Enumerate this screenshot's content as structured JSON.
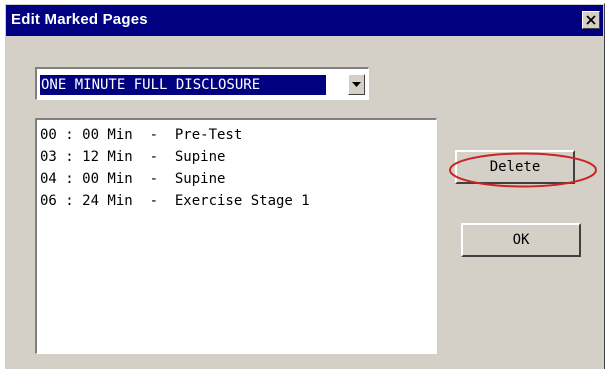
{
  "window": {
    "title": "Edit Marked Pages",
    "close_glyph": "✕"
  },
  "combo": {
    "selected": "ONE MINUTE FULL DISCLOSURE",
    "arrow_icon": "chevron-down-icon"
  },
  "marked_pages": [
    {
      "text": "00 : 00 Min  -  Pre-Test"
    },
    {
      "text": "03 : 12 Min  -  Supine"
    },
    {
      "text": "04 : 00 Min  -  Supine"
    },
    {
      "text": "06 : 24 Min  -  Exercise Stage 1"
    }
  ],
  "buttons": {
    "delete_label": "Delete",
    "ok_label": "OK"
  },
  "colors": {
    "title_bar": "#000080",
    "dialog_face": "#d4d0c8",
    "annotation_ellipse": "#cc2222"
  }
}
